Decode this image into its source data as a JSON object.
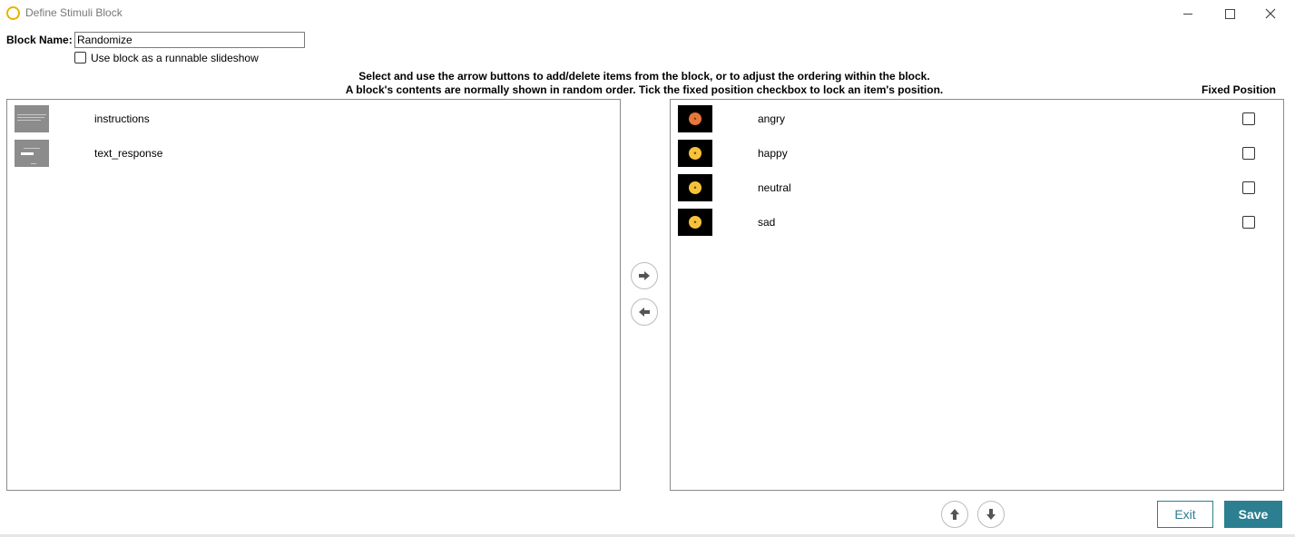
{
  "window": {
    "title": "Define Stimuli Block"
  },
  "block_name": {
    "label": "Block Name:",
    "value": "Randomize"
  },
  "slideshow": {
    "label": "Use block as a runnable slideshow",
    "checked": false
  },
  "instructions": {
    "line1": "Select and use the arrow buttons to add/delete items from the block, or to adjust the ordering within the block.",
    "line2": "A block's contents are normally shown in random order. Tick the fixed position checkbox to lock an item's position."
  },
  "fixed_position_header": "Fixed Position",
  "available_items": [
    {
      "label": "instructions",
      "thumb": "gray-text-slide"
    },
    {
      "label": "text_response",
      "thumb": "gray-input-slide"
    }
  ],
  "block_items": [
    {
      "label": "angry",
      "emoji": "angry-face",
      "fixed": false
    },
    {
      "label": "happy",
      "emoji": "happy-face",
      "fixed": false
    },
    {
      "label": "neutral",
      "emoji": "neutral-face",
      "fixed": false
    },
    {
      "label": "sad",
      "emoji": "sad-face",
      "fixed": false
    }
  ],
  "buttons": {
    "exit": "Exit",
    "save": "Save"
  },
  "colors": {
    "accent": "#2b7f91",
    "app_icon": "#e8b400"
  }
}
